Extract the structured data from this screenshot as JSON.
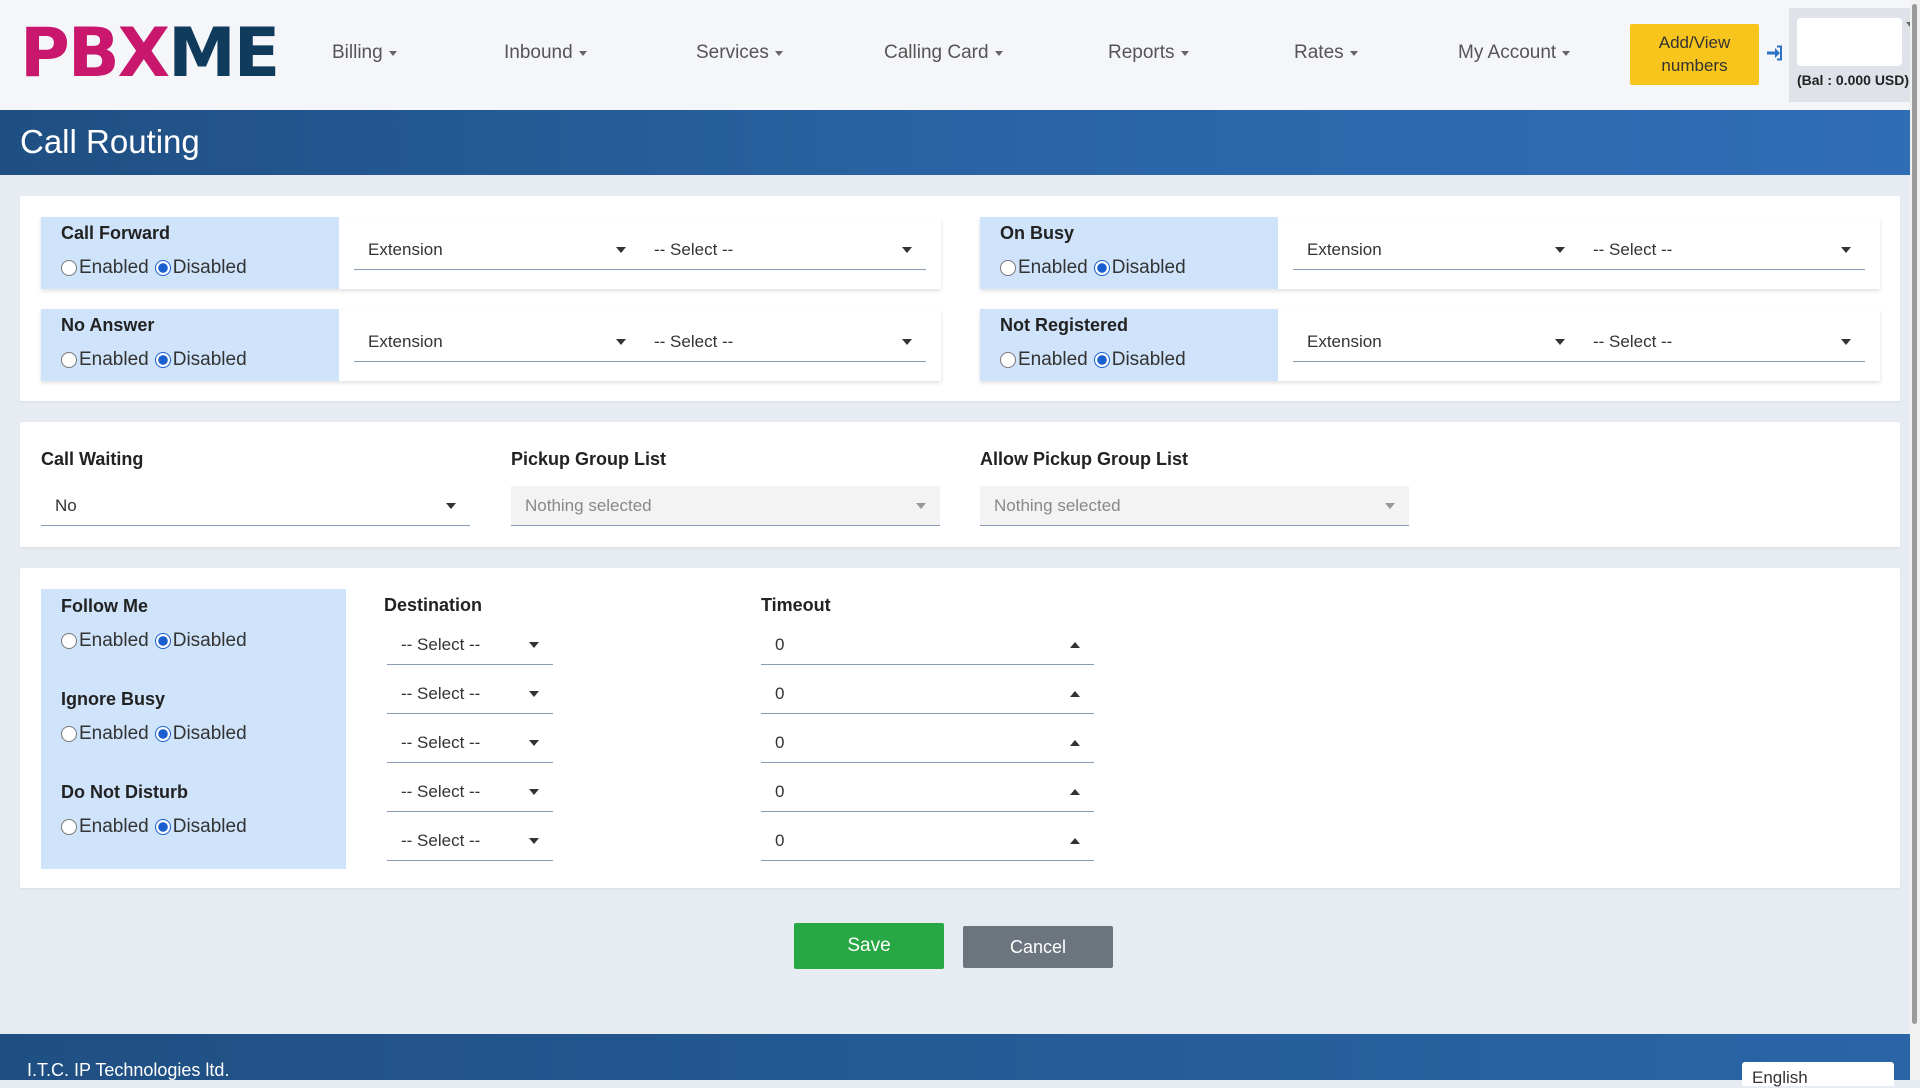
{
  "header": {
    "logo_part1": "PBX",
    "logo_part2": "ME",
    "nav": [
      "Billing",
      "Inbound",
      "Services",
      "Calling Card",
      "Reports",
      "Rates",
      "My Account"
    ],
    "add_view_line1": "Add/View",
    "add_view_line2": "numbers",
    "balance": "(Bal : 0.000 USD)",
    "login_icon": "sign-in-icon"
  },
  "page": {
    "title": "Call Routing"
  },
  "routing": {
    "call_forward": {
      "label": "Call Forward",
      "type": "Extension",
      "target": "-- Select --",
      "status": "Disabled"
    },
    "on_busy": {
      "label": "On Busy",
      "type": "Extension",
      "target": "-- Select --",
      "status": "Disabled"
    },
    "no_answer": {
      "label": "No Answer",
      "type": "Extension",
      "target": "-- Select --",
      "status": "Disabled"
    },
    "not_registered": {
      "label": "Not Registered",
      "type": "Extension",
      "target": "-- Select --",
      "status": "Disabled"
    },
    "enabled_label": "Enabled",
    "disabled_label": "Disabled"
  },
  "waiting": {
    "call_waiting_label": "Call Waiting",
    "call_waiting_value": "No",
    "pickup_label": "Pickup Group List",
    "pickup_value": "Nothing selected",
    "allow_pickup_label": "Allow Pickup Group List",
    "allow_pickup_value": "Nothing selected"
  },
  "follow": {
    "follow_me_label": "Follow Me",
    "follow_me_status": "Disabled",
    "ignore_busy_label": "Ignore Busy",
    "ignore_busy_status": "Disabled",
    "dnd_label": "Do Not Disturb",
    "dnd_status": "Disabled",
    "destination_label": "Destination",
    "timeout_label": "Timeout",
    "rows": [
      {
        "destination": "-- Select --",
        "timeout": "0"
      },
      {
        "destination": "-- Select --",
        "timeout": "0"
      },
      {
        "destination": "-- Select --",
        "timeout": "0"
      },
      {
        "destination": "-- Select --",
        "timeout": "0"
      },
      {
        "destination": "-- Select --",
        "timeout": "0"
      }
    ]
  },
  "actions": {
    "save": "Save",
    "cancel": "Cancel"
  },
  "footer": {
    "company": "I.T.C. IP Technologies ltd.",
    "language": "English"
  },
  "colors": {
    "accent": "#2b65a8",
    "save": "#28a745",
    "cancel": "#6c757d",
    "add_button": "#f7c51b",
    "label_bg": "#cfe3fb",
    "logo_pink": "#c8176d",
    "logo_navy": "#103b5c"
  }
}
